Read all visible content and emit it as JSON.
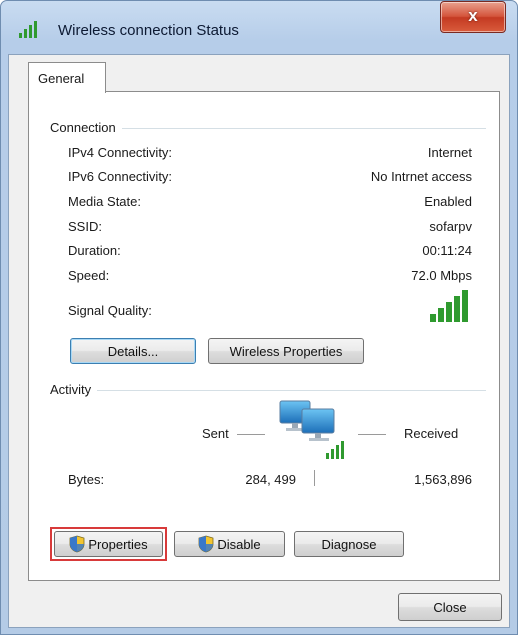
{
  "window": {
    "title": "Wireless connection Status",
    "close_glyph": "x"
  },
  "tabs": [
    {
      "label": "General"
    }
  ],
  "connection": {
    "group_label": "Connection",
    "rows": [
      {
        "label": "IPv4 Connectivity:",
        "value": "Internet"
      },
      {
        "label": "IPv6 Connectivity:",
        "value": "No Intrnet access"
      },
      {
        "label": "Media State:",
        "value": "Enabled"
      },
      {
        "label": "SSID:",
        "value": "sofarpv"
      },
      {
        "label": "Duration:",
        "value": "00:11:24"
      },
      {
        "label": "Speed:",
        "value": "72.0 Mbps"
      }
    ],
    "signal_label": "Signal Quality:",
    "signal_bars": 5,
    "details_button": "Details...",
    "wireless_props_button": "Wireless Properties"
  },
  "activity": {
    "group_label": "Activity",
    "sent_label": "Sent",
    "received_label": "Received",
    "bytes_label": "Bytes:",
    "bytes_sent": "284, 499",
    "bytes_received": "1,563,896"
  },
  "buttons": {
    "properties": "Properties",
    "disable": "Disable",
    "diagnose": "Diagnose",
    "close": "Close"
  },
  "colors": {
    "signal_green": "#2f9a2f",
    "highlight": "#d83a3a"
  }
}
